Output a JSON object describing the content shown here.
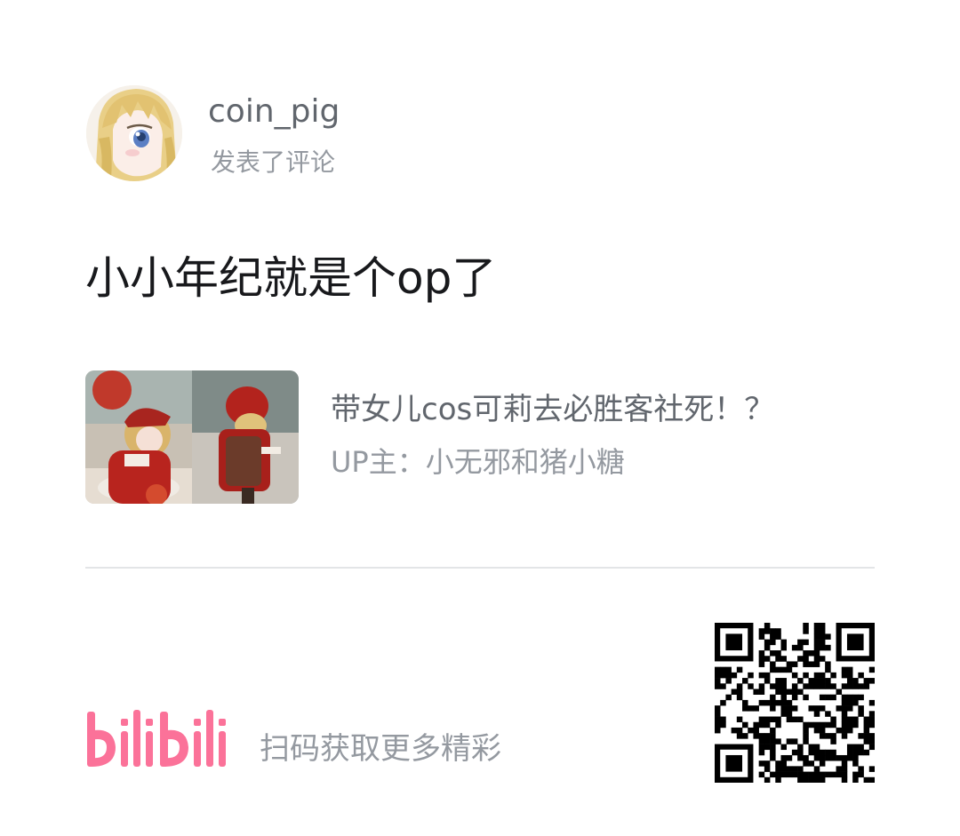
{
  "user": {
    "name": "coin_pig",
    "action": "发表了评论"
  },
  "comment": {
    "text": "小小年纪就是个op了"
  },
  "video": {
    "title": "带女儿cos可莉去必胜客社死！？",
    "uploader": "UP主：小无邪和猪小糖"
  },
  "footer": {
    "logo_text": "bilibili",
    "scan_text": "扫码获取更多精彩"
  },
  "colors": {
    "brand_pink": "#fb7299",
    "primary_text": "#18191c",
    "secondary_text": "#61666d",
    "tertiary_text": "#9499a0",
    "divider": "#e3e5e7"
  },
  "icons": {
    "avatar": "anime-avatar-image",
    "thumbnail": "video-thumbnail-image",
    "qr": "qr-code-image",
    "logo": "bilibili-logo"
  }
}
